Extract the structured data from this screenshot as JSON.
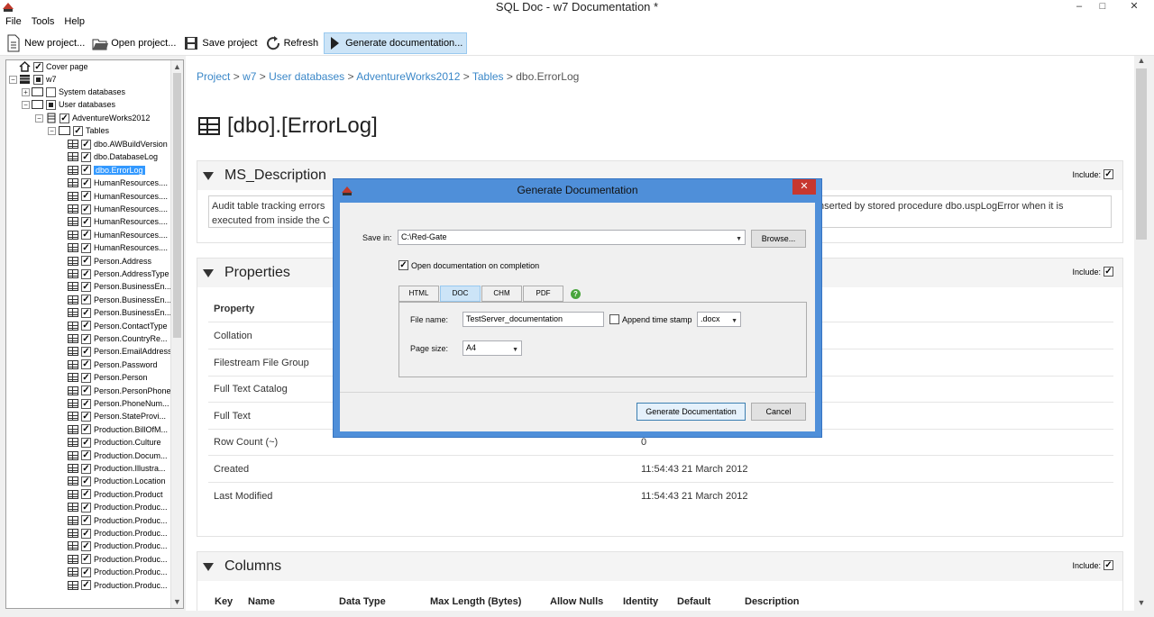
{
  "window": {
    "title": "SQL Doc - w7 Documentation *",
    "minimize": "–",
    "maximize": "□",
    "close": "✕"
  },
  "menu": {
    "file": "File",
    "tools": "Tools",
    "help": "Help"
  },
  "toolbar": {
    "new_project": "New project...",
    "open_project": "Open project...",
    "save_project": "Save project",
    "refresh": "Refresh",
    "generate": "Generate documentation..."
  },
  "tree": {
    "cover_page": "Cover page",
    "server": "w7",
    "system_databases": "System databases",
    "user_databases": "User databases",
    "database": "AdventureWorks2012",
    "tables_folder": "Tables",
    "tables": [
      "dbo.AWBuildVersion",
      "dbo.DatabaseLog",
      "dbo.ErrorLog",
      "HumanResources....",
      "HumanResources....",
      "HumanResources....",
      "HumanResources....",
      "HumanResources....",
      "HumanResources....",
      "Person.Address",
      "Person.AddressType",
      "Person.BusinessEn...",
      "Person.BusinessEn...",
      "Person.BusinessEn...",
      "Person.ContactType",
      "Person.CountryRe...",
      "Person.EmailAddress",
      "Person.Password",
      "Person.Person",
      "Person.PersonPhone",
      "Person.PhoneNum...",
      "Person.StateProvi...",
      "Production.BillOfM...",
      "Production.Culture",
      "Production.Docum...",
      "Production.Illustra...",
      "Production.Location",
      "Production.Product",
      "Production.Produc...",
      "Production.Produc...",
      "Production.Produc...",
      "Production.Produc...",
      "Production.Produc...",
      "Production.Produc...",
      "Production.Produc..."
    ]
  },
  "content": {
    "breadcrumb": {
      "project": "Project",
      "server": "w7",
      "user_databases": "User databases",
      "database": "AdventureWorks2012",
      "tables": "Tables",
      "current": "dbo.ErrorLog",
      "separator": ">"
    },
    "title": "[dbo].[ErrorLog]",
    "include_label": "Include:",
    "ms_description": {
      "title": "MS_Description",
      "text_left": "Audit table tracking errors",
      "text_left2": "executed from inside the C",
      "text_right": "nserted by stored procedure dbo.uspLogError when it is"
    },
    "properties": {
      "title": "Properties",
      "header": "Property",
      "rows": [
        {
          "name": "Collation",
          "value": ""
        },
        {
          "name": "Filestream File Group",
          "value": ""
        },
        {
          "name": "Full Text Catalog",
          "value": ""
        },
        {
          "name": "Full Text",
          "value": ""
        },
        {
          "name": "Row Count (~)",
          "value": "0"
        },
        {
          "name": "Created",
          "value": "11:54:43 21 March 2012"
        },
        {
          "name": "Last Modified",
          "value": "11:54:43 21 March 2012"
        }
      ]
    },
    "columns": {
      "title": "Columns",
      "headers": [
        "Key",
        "Name",
        "Data Type",
        "Max Length (Bytes)",
        "Allow Nulls",
        "Identity",
        "Default",
        "Description"
      ]
    }
  },
  "dialog": {
    "title": "Generate Documentation",
    "save_in_label": "Save in:",
    "save_in_value": "C:\\Red-Gate",
    "browse": "Browse...",
    "open_on_completion": "Open documentation on completion",
    "tabs": [
      "HTML",
      "DOC",
      "CHM",
      "PDF"
    ],
    "active_tab": "DOC",
    "file_name_label": "File name:",
    "file_name_value": "TestServer_documentation",
    "append_timestamp": "Append time stamp",
    "extension": ".docx",
    "page_size_label": "Page size:",
    "page_size_value": "A4",
    "generate_button": "Generate Documentation",
    "cancel_button": "Cancel",
    "help": "?"
  }
}
